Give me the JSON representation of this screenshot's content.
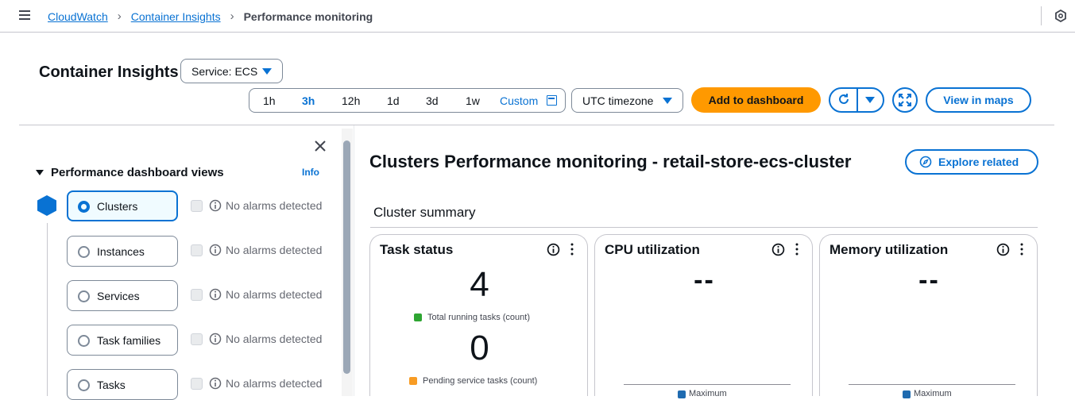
{
  "breadcrumb": {
    "items": [
      "CloudWatch",
      "Container Insights"
    ],
    "current": "Performance monitoring"
  },
  "header": {
    "title": "Container Insights",
    "service_select": "Service: ECS",
    "time_range": {
      "options": [
        "1h",
        "3h",
        "12h",
        "1d",
        "3d",
        "1w"
      ],
      "selected": "3h",
      "custom_label": "Custom"
    },
    "timezone_select": "UTC timezone",
    "add_to_dashboard": "Add to dashboard",
    "view_in_maps": "View in maps"
  },
  "sidebar": {
    "section_title": "Performance dashboard views",
    "info_link": "Info",
    "views": [
      {
        "label": "Clusters",
        "selected": true,
        "alarm_text": "No alarms detected"
      },
      {
        "label": "Instances",
        "selected": false,
        "alarm_text": "No alarms detected"
      },
      {
        "label": "Services",
        "selected": false,
        "alarm_text": "No alarms detected"
      },
      {
        "label": "Task families",
        "selected": false,
        "alarm_text": "No alarms detected"
      },
      {
        "label": "Tasks",
        "selected": false,
        "alarm_text": "No alarms detected"
      }
    ]
  },
  "main": {
    "title": "Clusters Performance monitoring - retail-store-ecs-cluster",
    "explore_related": "Explore related",
    "section_title": "Cluster summary",
    "cards": [
      {
        "title": "Task status",
        "metrics": [
          {
            "value": "4",
            "label": "Total running tasks (count)",
            "color": "#2ea532"
          },
          {
            "value": "0",
            "label": "Pending service tasks (count)",
            "color": "#f89c24"
          }
        ]
      },
      {
        "title": "CPU utilization",
        "value": "--",
        "legend": "Maximum"
      },
      {
        "title": "Memory utilization",
        "value": "--",
        "legend": "Maximum"
      }
    ]
  },
  "colors": {
    "accent": "#0972d3",
    "primary_button": "#ff9900",
    "text": "#0f141a"
  }
}
